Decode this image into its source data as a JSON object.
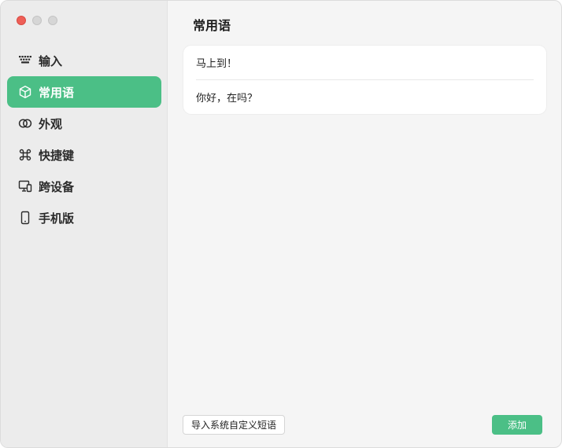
{
  "window": {
    "traffic_lights": [
      "close",
      "minimize",
      "zoom"
    ]
  },
  "sidebar": {
    "items": [
      {
        "label": "输入",
        "icon": "keyboard-icon",
        "active": false
      },
      {
        "label": "常用语",
        "icon": "cube-icon",
        "active": true
      },
      {
        "label": "外观",
        "icon": "overlap-circles-icon",
        "active": false
      },
      {
        "label": "快捷键",
        "icon": "command-icon",
        "active": false
      },
      {
        "label": "跨设备",
        "icon": "devices-icon",
        "active": false
      },
      {
        "label": "手机版",
        "icon": "phone-icon",
        "active": false
      }
    ]
  },
  "main": {
    "title": "常用语",
    "phrases": [
      "马上到！",
      "你好，在吗？"
    ],
    "import_button": "导入系统自定义短语",
    "add_button": "添加"
  },
  "colors": {
    "accent": "#4bbf86",
    "sidebar_bg": "#ececec",
    "content_bg": "#f5f5f5"
  }
}
